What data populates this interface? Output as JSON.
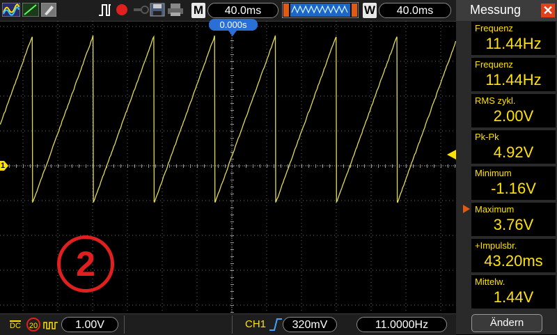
{
  "toolbar": {
    "timebase": "40.0ms",
    "window_timebase": "40.0ms",
    "m_label": "M",
    "w_label": "W",
    "trigger_offset": "0.000s",
    "icons": [
      "waveform-view-icon",
      "ramp-icon",
      "probe-icon",
      "trigger-mode-icon",
      "record-dot-icon",
      "key-icon",
      "save-icon",
      "print-icon",
      "buffer-waveform-icon"
    ]
  },
  "screen": {
    "channel_marker": "1",
    "badge_number": "2"
  },
  "bottom": {
    "coupling": "DC",
    "bw_limit": "20",
    "volts_per_div": "1.00V",
    "trigger_source": "CH1",
    "trigger_level": "320mV",
    "counter": "11.0000Hz"
  },
  "panel": {
    "title": "Messung",
    "measurements": [
      {
        "label": "Frequenz",
        "value": "11.44Hz"
      },
      {
        "label": "Frequenz",
        "value": "11.44Hz"
      },
      {
        "label": "RMS  zykl.",
        "value": "2.00V"
      },
      {
        "label": "Pk-Pk",
        "value": "4.92V"
      },
      {
        "label": "Minimum",
        "value": "-1.16V"
      },
      {
        "label": "Maximum",
        "value": "3.76V"
      },
      {
        "label": "+Impulsbr.",
        "value": "43.20ms"
      },
      {
        "label": "Mittelw.",
        "value": "1.44V"
      }
    ],
    "change_button": "Ändern"
  },
  "colors": {
    "trace": "#e4dc55",
    "accent_red": "#e0201e",
    "trigger_blue": "#2a6fd6",
    "measure_text": "#ffe200"
  }
}
